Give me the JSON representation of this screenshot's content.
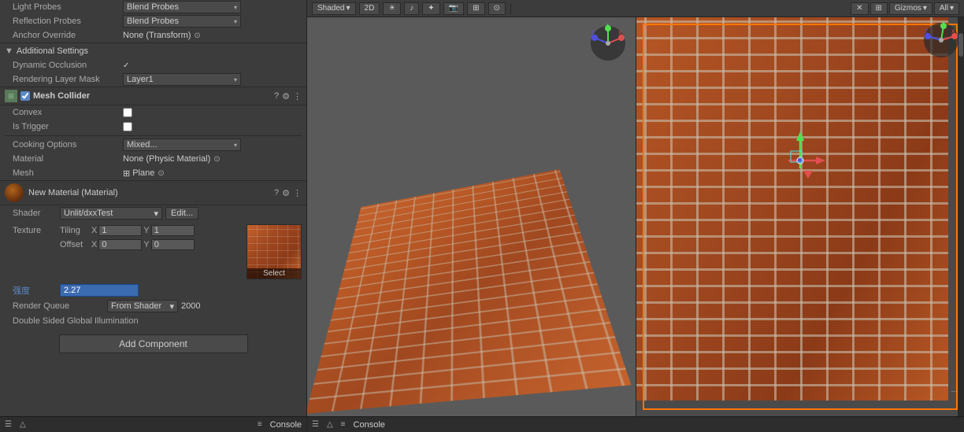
{
  "inspector": {
    "light_probes_label": "Light Probes",
    "light_probes_value": "Blend Probes",
    "reflection_probes_label": "Reflection Probes",
    "reflection_probes_value": "Blend Probes",
    "anchor_override_label": "Anchor Override",
    "anchor_override_value": "None (Transform)",
    "additional_settings_label": "Additional Settings",
    "dynamic_occlusion_label": "Dynamic Occlusion",
    "rendering_layer_label": "Rendering Layer Mask",
    "rendering_layer_value": "Layer1",
    "mesh_collider_label": "Mesh Collider",
    "convex_label": "Convex",
    "is_trigger_label": "Is Trigger",
    "cooking_options_label": "Cooking Options",
    "cooking_options_value": "Mixed...",
    "material_label": "Material",
    "material_value": "None (Physic Material)",
    "mesh_label": "Mesh",
    "mesh_value": "Plane",
    "new_material_label": "New Material (Material)",
    "shader_label": "Shader",
    "shader_value": "Unlit/dxxTest",
    "edit_label": "Edit...",
    "texture_label": "Texture",
    "tiling_label": "Tiling",
    "tiling_x": "1",
    "tiling_y": "1",
    "offset_label": "Offset",
    "offset_x": "0",
    "offset_y": "0",
    "select_label": "Select",
    "strength_label": "强度",
    "strength_value": "2.27",
    "render_queue_label": "Render Queue",
    "render_queue_dropdown": "From Shader",
    "render_queue_value": "2000",
    "double_sided_label": "Double Sided Global Illumination",
    "add_component_label": "Add Component"
  },
  "toolbar": {
    "shaded_label": "Shaded",
    "two_d_label": "2D",
    "gizmos_label": "Gizmos",
    "all_label": "All"
  },
  "viewport": {
    "left_grid_color": "#5a5a5a",
    "right_grid_color": "#4a4a4a",
    "selection_color": "#ff7700"
  },
  "bottom_bar": {
    "console_label": "Console"
  },
  "icons": {
    "question_mark": "?",
    "settings": "☰",
    "more": "⋮",
    "check": "✓",
    "arrow_down": "▾",
    "arrow_right": "▶",
    "fold_open": "▼",
    "fold_closed": "▶"
  }
}
